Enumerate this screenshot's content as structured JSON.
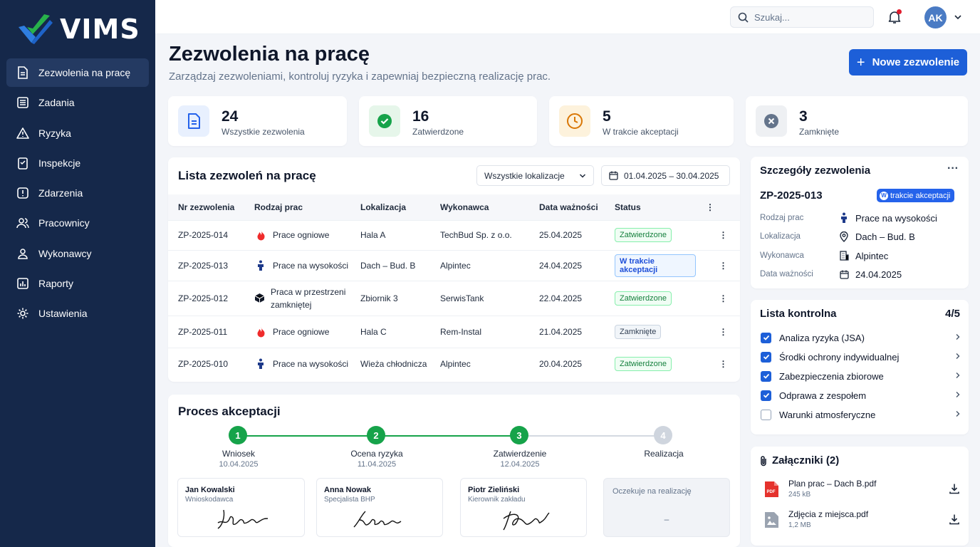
{
  "app": {
    "name": "VIMS"
  },
  "sidebar": {
    "items": [
      {
        "label": "Zezwolenia na pracę",
        "icon": "document-icon",
        "active": true
      },
      {
        "label": "Zadania",
        "icon": "tasks-icon"
      },
      {
        "label": "Ryzyka",
        "icon": "warning-icon"
      },
      {
        "label": "Inspekcje",
        "icon": "clipboard-icon"
      },
      {
        "label": "Zdarzenia",
        "icon": "alert-icon"
      },
      {
        "label": "Pracownicy",
        "icon": "users-icon"
      },
      {
        "label": "Wykonawcy",
        "icon": "contractors-icon"
      },
      {
        "label": "Raporty",
        "icon": "report-icon"
      },
      {
        "label": "Ustawienia",
        "icon": "gear-icon"
      }
    ]
  },
  "header": {
    "search_placeholder": "Szukaj...",
    "user_initials": "AK",
    "has_notification": true
  },
  "page": {
    "title": "Zezwolenia na pracę",
    "subtitle": "Zarządzaj zezwoleniami, kontroluj ryzyka i zapewniaj bezpieczną realizację prac.",
    "new_button": "Nowe zezwolenie"
  },
  "stats": [
    {
      "value": "24",
      "label": "Wszystkie zezwolenia",
      "icon": "document-icon",
      "color": "#2563eb",
      "bg": "#e8f0fe"
    },
    {
      "value": "16",
      "label": "Zatwierdzone",
      "icon": "check-circle-icon",
      "color": "#16a34a",
      "bg": "#e6f6ea"
    },
    {
      "value": "5",
      "label": "W trakcie akceptacji",
      "icon": "clock-icon",
      "color": "#d97706",
      "bg": "#fdf2dc"
    },
    {
      "value": "3",
      "label": "Zamknięte",
      "icon": "x-circle-icon",
      "color": "#64748b",
      "bg": "#eef0f3"
    }
  ],
  "list": {
    "title": "Lista zezwoleń na pracę",
    "location_filter": "Wszystkie lokalizacje",
    "date_range": "01.04.2025 – 30.04.2025",
    "columns": [
      "Nr zezwolenia",
      "Rodzaj prac",
      "Lokalizacja",
      "Wykonawca",
      "Data ważności",
      "Status"
    ],
    "rows": [
      {
        "id": "ZP-2025-014",
        "type": "Prace ogniowe",
        "type_icon": "fire-icon",
        "location": "Hala A",
        "contractor": "TechBud Sp. z o.o.",
        "valid": "25.04.2025",
        "status": "Zatwierdzone",
        "status_kind": "green"
      },
      {
        "id": "ZP-2025-013",
        "type": "Prace na wysokości",
        "type_icon": "worker-icon",
        "location": "Dach – Bud. B",
        "contractor": "Alpintec",
        "valid": "24.04.2025",
        "status": "W trakcie akceptacji",
        "status_kind": "blue"
      },
      {
        "id": "ZP-2025-012",
        "type": "Praca w przestrzeni zamkniętej",
        "type_icon": "box-icon",
        "location": "Zbiornik 3",
        "contractor": "SerwisTank",
        "valid": "22.04.2025",
        "status": "Zatwierdzone",
        "status_kind": "green"
      },
      {
        "id": "ZP-2025-011",
        "type": "Prace ogniowe",
        "type_icon": "fire-icon",
        "location": "Hala C",
        "contractor": "Rem-Instal",
        "valid": "21.04.2025",
        "status": "Zamknięte",
        "status_kind": "gray"
      },
      {
        "id": "ZP-2025-010",
        "type": "Prace na wysokości",
        "type_icon": "worker-icon",
        "location": "Wieża chłodnicza",
        "contractor": "Alpintec",
        "valid": "20.04.2025",
        "status": "Zatwierdzone",
        "status_kind": "green"
      }
    ]
  },
  "process": {
    "title": "Proces akceptacji",
    "steps": [
      {
        "num": "1",
        "name": "Wniosek",
        "date": "10.04.2025",
        "done": true
      },
      {
        "num": "2",
        "name": "Ocena ryzyka",
        "date": "11.04.2025",
        "done": true
      },
      {
        "num": "3",
        "name": "Zatwierdzenie",
        "date": "12.04.2025",
        "done": true
      },
      {
        "num": "4",
        "name": "Realizacja",
        "date": "",
        "done": false
      }
    ],
    "signatures": [
      {
        "name": "Jan Kowalski",
        "role": "Wnioskodawca"
      },
      {
        "name": "Anna Nowak",
        "role": "Specjalista BHP"
      },
      {
        "name": "Piotr Zieliński",
        "role": "Kierownik zakładu"
      }
    ],
    "pending_text": "Oczekuje na realizację",
    "pending_dash": "–"
  },
  "details": {
    "title": "Szczegóły zezwolenia",
    "more": "···",
    "code": "ZP-2025-013",
    "badge": "W trakcie akceptacji",
    "badge_visible": "trakcie akceptacji",
    "fields": [
      {
        "key": "Rodzaj prac",
        "value": "Prace na wysokości",
        "icon": "worker-icon"
      },
      {
        "key": "Lokalizacja",
        "value": "Dach – Bud. B",
        "icon": "pin-icon"
      },
      {
        "key": "Wykonawca",
        "value": "Alpintec",
        "icon": "building-icon"
      },
      {
        "key": "Data ważności",
        "value": "24.04.2025",
        "icon": "calendar-icon"
      }
    ]
  },
  "checklist": {
    "title": "Lista kontrolna",
    "count": "4/5",
    "items": [
      {
        "label": "Analiza ryzyka (JSA)",
        "checked": true
      },
      {
        "label": "Środki ochrony indywidualnej",
        "checked": true
      },
      {
        "label": "Zabezpieczenia zbiorowe",
        "checked": true
      },
      {
        "label": "Odprawa z zespołem",
        "checked": true
      },
      {
        "label": "Warunki atmosferyczne",
        "checked": false
      }
    ]
  },
  "attachments": {
    "title": "Załączniki (2)",
    "files": [
      {
        "name": "Plan prac – Dach B.pdf",
        "size": "245 kB",
        "icon": "pdf-icon",
        "icon_text": "PDF"
      },
      {
        "name": "Zdjęcia z miejsca.pdf",
        "size": "1,2 MB",
        "icon": "image-file-icon"
      }
    ]
  }
}
